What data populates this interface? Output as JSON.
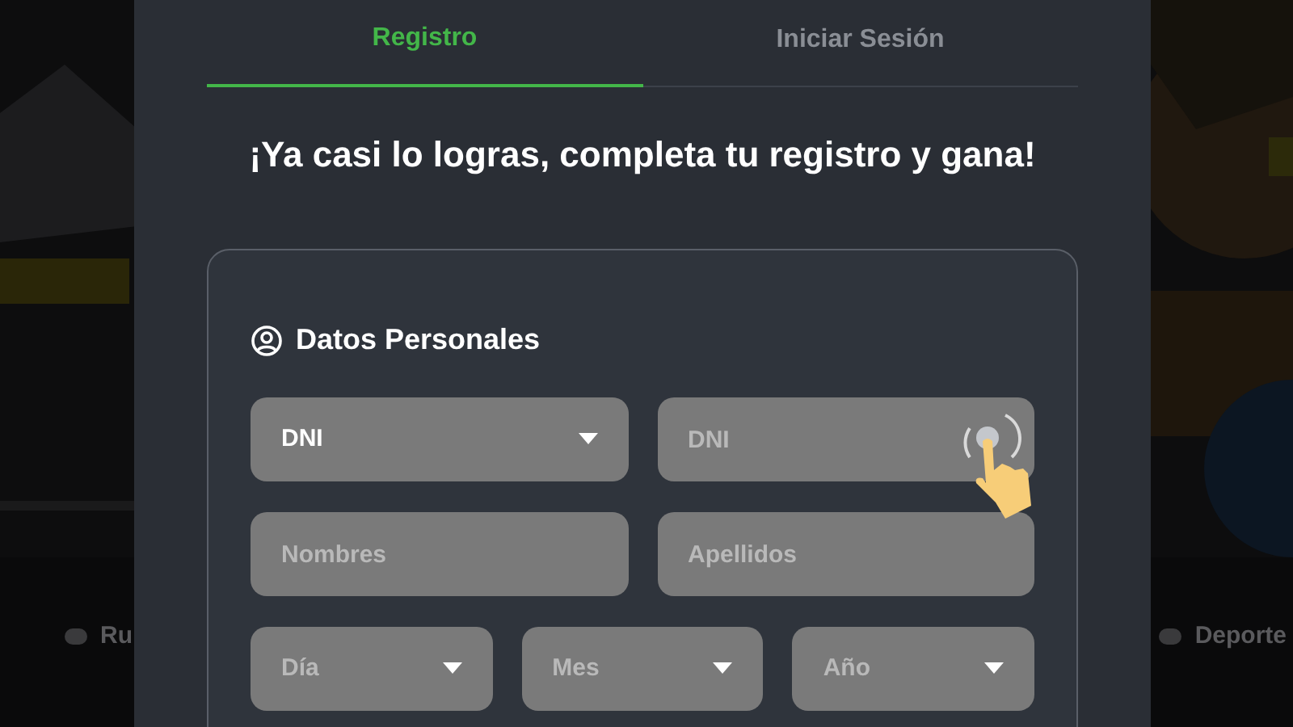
{
  "background": {
    "nav_items": [
      {
        "label": "Ru"
      },
      {
        "label": "Deporte"
      }
    ]
  },
  "tabs": [
    {
      "label": "Registro",
      "selected": true
    },
    {
      "label": "Iniciar Sesión",
      "selected": false
    }
  ],
  "heading": "¡Ya casi lo logras, completa tu registro y gana!",
  "section": {
    "title": "Datos Personales",
    "rows": [
      [
        {
          "kind": "select",
          "value": "DNI"
        },
        {
          "kind": "input",
          "placeholder": "DNI"
        }
      ],
      [
        {
          "kind": "input",
          "placeholder": "Nombres"
        },
        {
          "kind": "input",
          "placeholder": "Apellidos"
        }
      ],
      [
        {
          "kind": "select",
          "placeholder": "Día"
        },
        {
          "kind": "select",
          "placeholder": "Mes"
        },
        {
          "kind": "select",
          "placeholder": "Año"
        }
      ]
    ]
  }
}
